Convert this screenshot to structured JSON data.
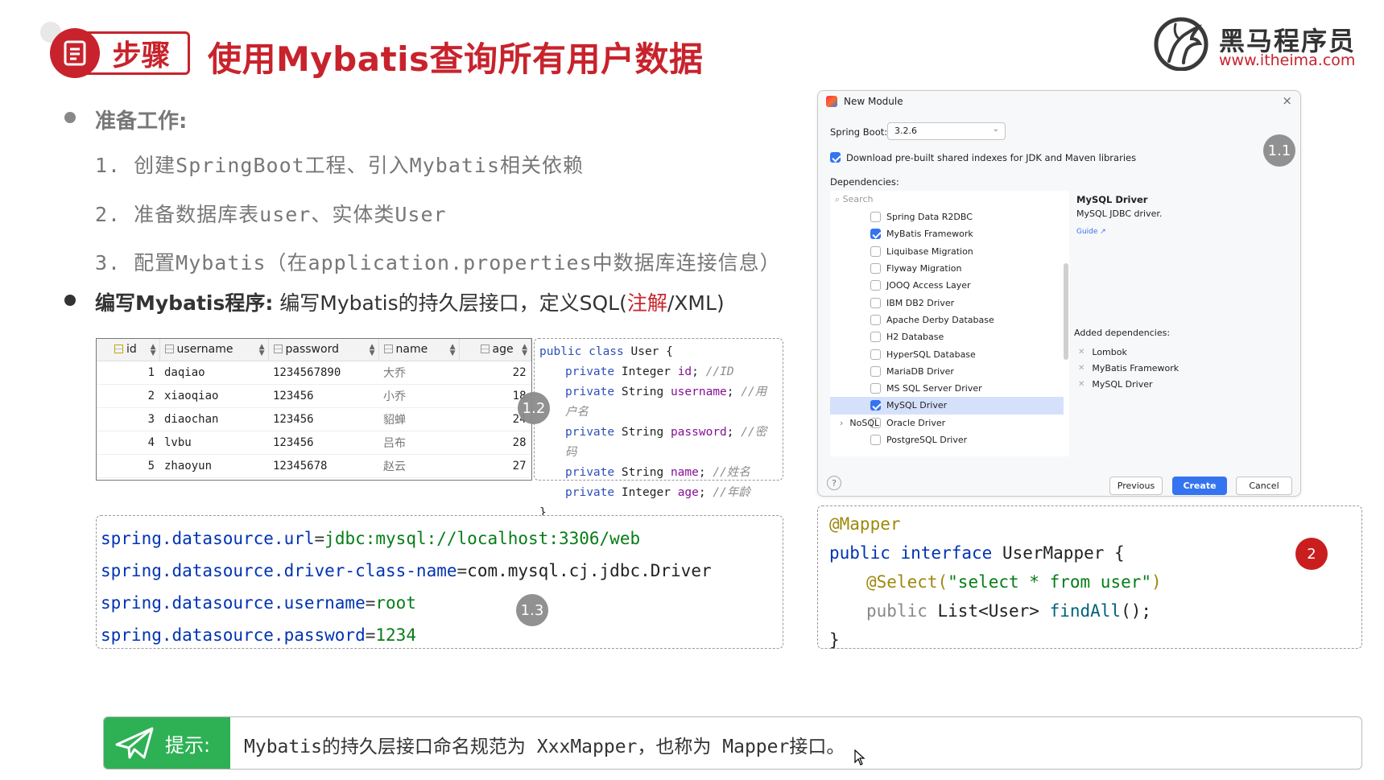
{
  "header": {
    "badge_label": "步骤",
    "title": "使用Mybatis查询所有用户数据",
    "logo_cn": "黑马程序员",
    "logo_url": "www.itheima.com"
  },
  "prep": {
    "title": "准备工作:",
    "steps": [
      "1. 创建SpringBoot工程、引入Mybatis相关依赖",
      "2. 准备数据库表user、实体类User",
      "3. 配置Mybatis（在application.properties中数据库连接信息）"
    ]
  },
  "write": {
    "strong": "编写Mybatis程序:",
    "text": " 编写Mybatis的持久层接口，定义SQL(",
    "red": "注解",
    "tail": "/XML)"
  },
  "db_table": {
    "columns": [
      "id",
      "username",
      "password",
      "name",
      "age"
    ],
    "rows": [
      [
        "1",
        "daqiao",
        "1234567890",
        "大乔",
        "22"
      ],
      [
        "2",
        "xiaoqiao",
        "123456",
        "小乔",
        "18"
      ],
      [
        "3",
        "diaochan",
        "123456",
        "貂蝉",
        "24"
      ],
      [
        "4",
        "lvbu",
        "123456",
        "吕布",
        "28"
      ],
      [
        "5",
        "zhaoyun",
        "12345678",
        "赵云",
        "27"
      ]
    ]
  },
  "class_code": {
    "l1_kw": "public class",
    "l1_name": " User {",
    "fields": [
      {
        "mod": "private ",
        "type": "Integer ",
        "name": "id",
        "cmt": "//ID"
      },
      {
        "mod": "private ",
        "type": "String ",
        "name": "username",
        "cmt": "//用户名"
      },
      {
        "mod": "private ",
        "type": "String ",
        "name": "password",
        "cmt": "//密码"
      },
      {
        "mod": "private ",
        "type": "String ",
        "name": "name",
        "cmt": "//姓名"
      },
      {
        "mod": "private ",
        "type": "Integer ",
        "name": "age",
        "cmt": "//年龄"
      }
    ],
    "close": "}"
  },
  "props": [
    {
      "key": "spring.datasource.url",
      "eq": "=",
      "val": "jdbc:mysql://localhost:3306/web",
      "green": true
    },
    {
      "key": "spring.datasource.driver-class-name",
      "eq": "=",
      "val": "com.mysql.cj.jdbc.Driver",
      "green": false
    },
    {
      "key": "spring.datasource.username",
      "eq": "=",
      "val": "root",
      "green": true
    },
    {
      "key": "spring.datasource.password",
      "eq": "=",
      "val": "1234",
      "green": true
    }
  ],
  "mapper": {
    "anno": "@Mapper",
    "decl_kw": "public interface",
    "decl_name": " UserMapper {",
    "select_anno": "@Select(",
    "select_str": "\"select * from user\"",
    "select_close": ")",
    "method_kw": "public",
    "method_type": " List<User> ",
    "method_name": "findAll",
    "method_tail": "();",
    "close": "}"
  },
  "badges": {
    "b11": "1.1",
    "b12": "1.2",
    "b13": "1.3",
    "b2": "2"
  },
  "dialog": {
    "title": "New Module",
    "spring_boot_label": "Spring Boot:",
    "spring_boot_version": "3.2.6",
    "download_label": "Download pre-built shared indexes for JDK and Maven libraries",
    "dependencies_label": "Dependencies:",
    "search_placeholder": "Search",
    "deps": [
      {
        "label": "Spring Data R2DBC",
        "checked": false
      },
      {
        "label": "MyBatis Framework",
        "checked": true
      },
      {
        "label": "Liquibase Migration",
        "checked": false
      },
      {
        "label": "Flyway Migration",
        "checked": false
      },
      {
        "label": "JOOQ Access Layer",
        "checked": false
      },
      {
        "label": "IBM DB2 Driver",
        "checked": false
      },
      {
        "label": "Apache Derby Database",
        "checked": false
      },
      {
        "label": "H2 Database",
        "checked": false
      },
      {
        "label": "HyperSQL Database",
        "checked": false
      },
      {
        "label": "MariaDB Driver",
        "checked": false
      },
      {
        "label": "MS SQL Server Driver",
        "checked": false
      },
      {
        "label": "MySQL Driver",
        "checked": true,
        "selected": true
      },
      {
        "label": "Oracle Driver",
        "checked": false
      },
      {
        "label": "PostgreSQL Driver",
        "checked": false
      }
    ],
    "nosql_label": "NoSQL",
    "info_title": "MySQL Driver",
    "info_desc": "MySQL JDBC driver.",
    "guide_label": "Guide ↗",
    "added_label": "Added dependencies:",
    "added": [
      "Lombok",
      "MyBatis Framework",
      "MySQL Driver"
    ],
    "btn_previous": "Previous",
    "btn_create": "Create",
    "btn_cancel": "Cancel",
    "help": "?"
  },
  "tip": {
    "label": "提示:",
    "text": "Mybatis的持久层接口命名规范为 XxxMapper，也称为 Mapper接口。"
  },
  "colors": {
    "brand_red": "#c8232c",
    "tip_green": "#2eb155",
    "accent_blue": "#3574f0"
  }
}
